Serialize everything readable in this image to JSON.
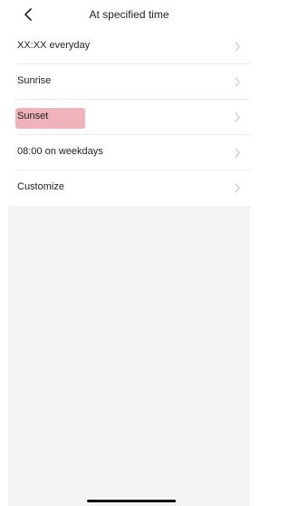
{
  "header": {
    "title": "At specified time",
    "back_icon": "chevron-left-icon"
  },
  "options": [
    {
      "label": "XX:XX everyday"
    },
    {
      "label": "Sunrise"
    },
    {
      "label": "Sunset",
      "highlighted": true
    },
    {
      "label": "08:00 on weekdays"
    },
    {
      "label": "Customize"
    }
  ],
  "colors": {
    "highlight": "#f0b3bb",
    "divider": "#ececec",
    "background": "#f4f4f4",
    "chevron": "#c8c8c8"
  }
}
